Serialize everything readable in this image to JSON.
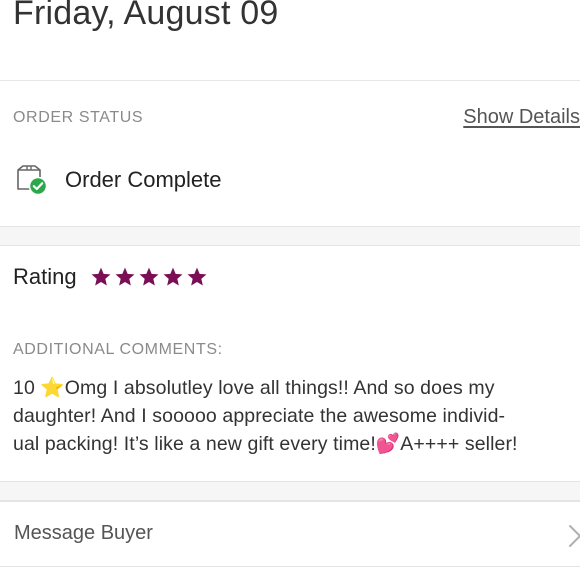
{
  "header": {
    "date": "Friday, August 09"
  },
  "order_status": {
    "section_label": "ORDER STATUS",
    "show_details_label": "Show Details",
    "status_icon": "package-check-icon",
    "status_text": "Order Complete"
  },
  "rating": {
    "label": "Rating",
    "stars": 5,
    "max_stars": 5,
    "star_color": "#7a0f55"
  },
  "comments": {
    "section_label": "ADDITIONAL COMMENTS:",
    "lines": [
      "10 ⭐Omg I absolutley love all things!! And so does my",
      "daughter! And I sooooo appreciate the awesome individ-",
      "ual packing! It’s like a new gift every time!💕A++++ seller!"
    ]
  },
  "message": {
    "label": "Message Buyer",
    "icon": "chevron-right-icon"
  },
  "colors": {
    "status_check": "#2aa84a",
    "star": "#7a0f55",
    "muted_label": "#8a8a8a"
  }
}
